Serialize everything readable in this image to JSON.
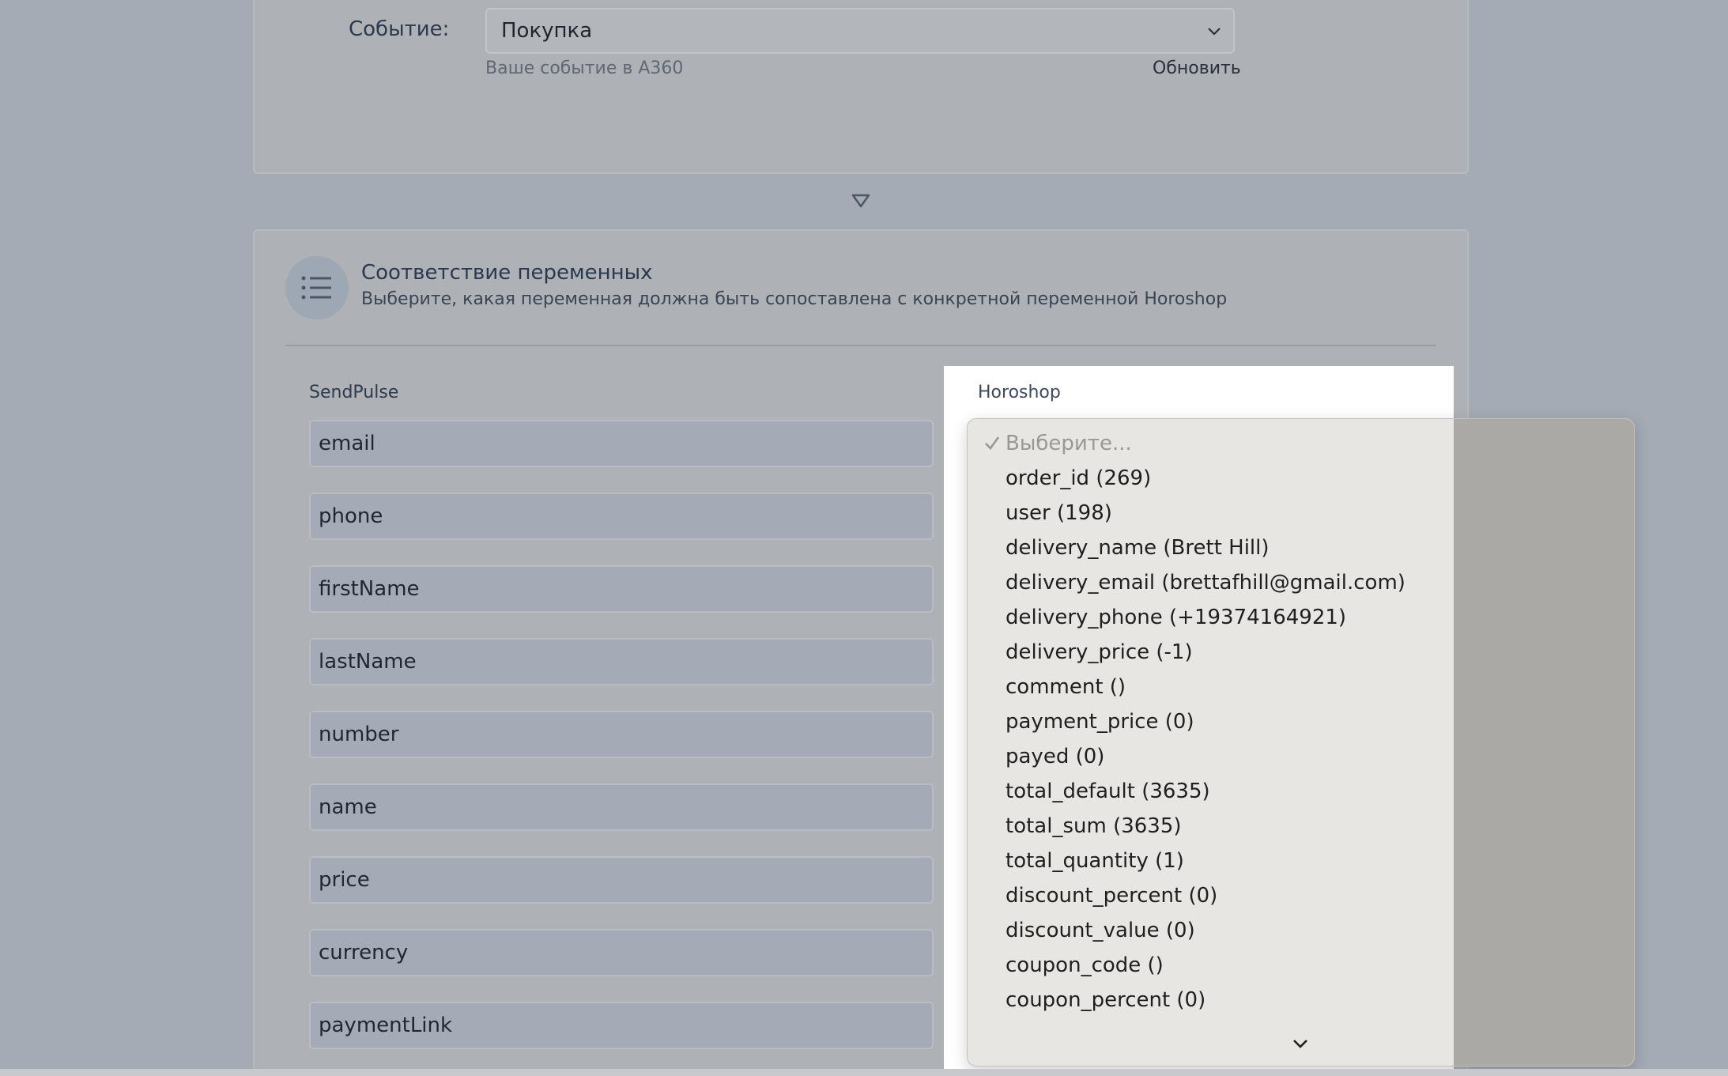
{
  "event": {
    "label": "Событие:",
    "selected": "Покупка",
    "hint": "Ваше событие в A360",
    "refresh": "Обновить"
  },
  "section": {
    "title": "Соответствие переменных",
    "subtitle": "Выберите, какая переменная должна быть сопоставлена с конкретной переменной Horoshop"
  },
  "columns": {
    "left": "SendPulse",
    "right": "Horoshop"
  },
  "fields": [
    "email",
    "phone",
    "firstName",
    "lastName",
    "number",
    "name",
    "price",
    "currency",
    "paymentLink"
  ],
  "dropdown": {
    "placeholder": "Выберите...",
    "options": [
      "order_id (269)",
      "user (198)",
      "delivery_name (Brett Hill)",
      "delivery_email (brettafhill@gmail.com)",
      "delivery_phone (+19374164921)",
      "delivery_price (-1)",
      "comment ()",
      "payment_price (0)",
      "payed (0)",
      "total_default (3635)",
      "total_sum (3635)",
      "total_quantity (1)",
      "discount_percent (0)",
      "discount_value (0)",
      "coupon_code ()",
      "coupon_percent (0)"
    ]
  },
  "colors": {
    "background": "#a4abb5",
    "card": "#aeb1b6",
    "dropdown_bg": "#e8e6e3",
    "text_dark": "#1f2731"
  },
  "icons": [
    "chevron-down-icon",
    "triangle-down-icon",
    "list-icon",
    "checkmark-icon"
  ]
}
